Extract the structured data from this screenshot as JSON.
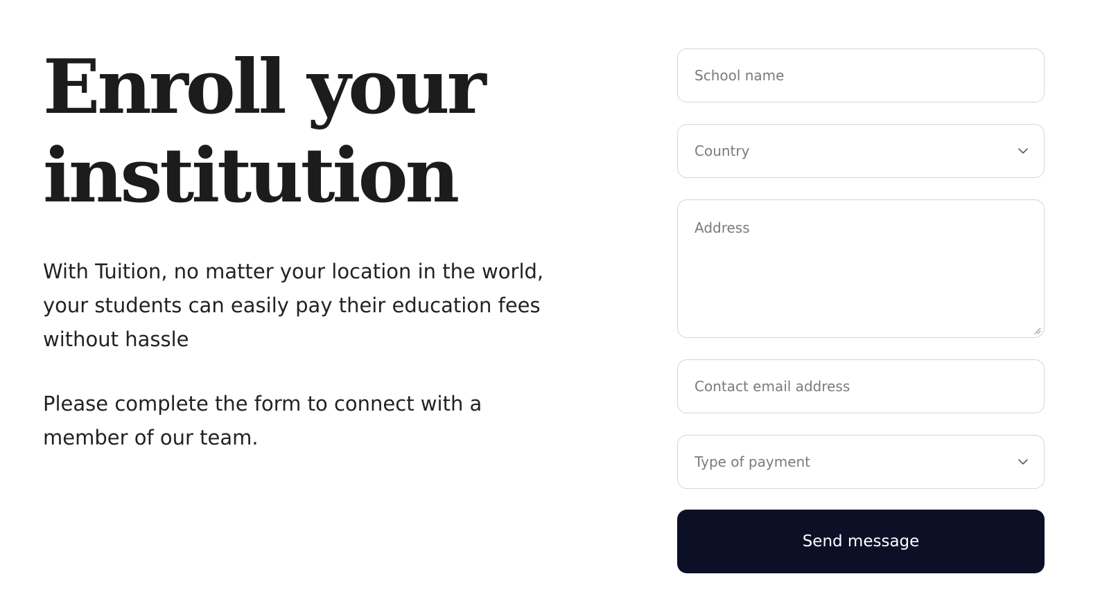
{
  "hero": {
    "headline_line1": "Enroll your",
    "headline_line2": "institution",
    "lead": "With Tuition, no matter your location in the world, your students can easily pay their education fees without hassle",
    "note": "Please complete the form to connect with a member of our team."
  },
  "form": {
    "school_name_placeholder": "School name",
    "country_placeholder": "Country",
    "address_placeholder": "Address",
    "email_placeholder": "Contact email address",
    "payment_type_placeholder": "Type of payment",
    "submit_label": "Send message"
  },
  "icons": {
    "country_dropdown": "chevron-down-icon",
    "payment_dropdown": "chevron-down-icon",
    "address_resize": "resize-handle-icon"
  },
  "colors": {
    "button_bg": "#0c1027",
    "border": "#d5d5d8",
    "placeholder": "#7a7a7f",
    "text": "#1c1c1c"
  }
}
